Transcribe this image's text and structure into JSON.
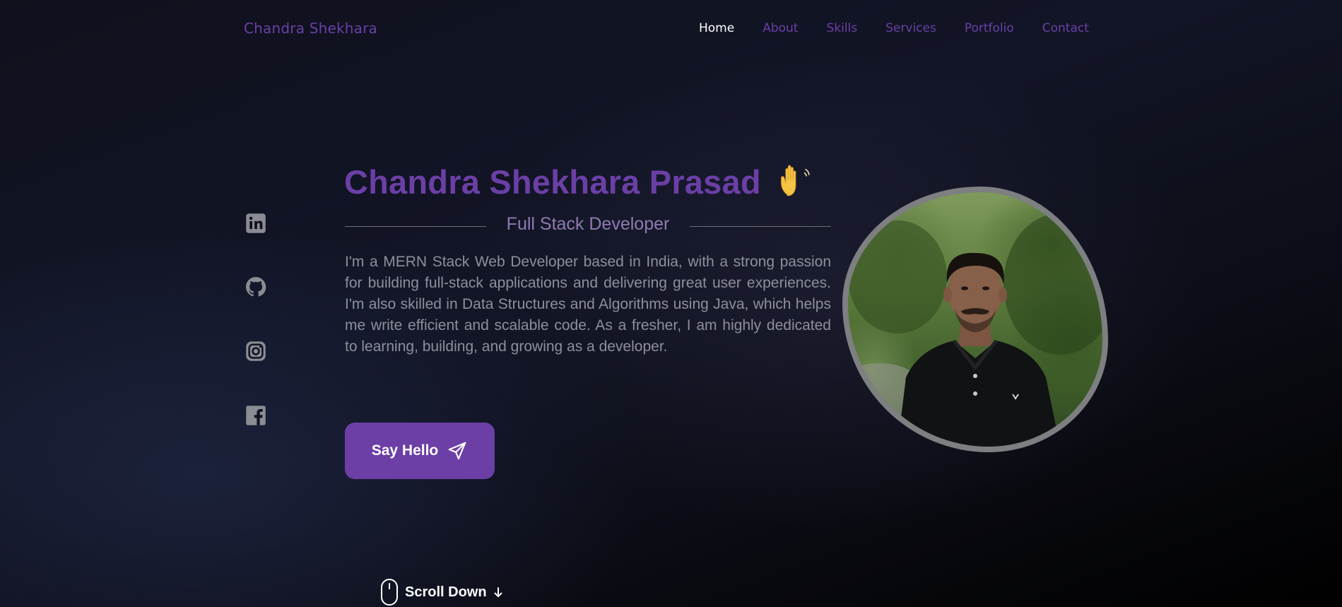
{
  "brand": "Chandra Shekhara",
  "nav": [
    {
      "label": "Home",
      "active": true
    },
    {
      "label": "About",
      "active": false
    },
    {
      "label": "Skills",
      "active": false
    },
    {
      "label": "Services",
      "active": false
    },
    {
      "label": "Portfolio",
      "active": false
    },
    {
      "label": "Contact",
      "active": false
    }
  ],
  "social": [
    "linkedin-icon",
    "github-icon",
    "instagram-icon",
    "facebook-icon"
  ],
  "hero": {
    "name": "Chandra Shekhara Prasad",
    "wave_icon": "waving-hand-icon",
    "subtitle": "Full Stack Developer",
    "bio": "I'm a MERN Stack Web Developer based in India, with a strong passion for building full-stack applications and delivering great user experiences. I'm also skilled in Data Structures and Algorithms using Java, which helps me write efficient and scalable code. As a fresher, I am highly dedicated to learning, building, and growing as a developer.",
    "cta_label": "Say Hello",
    "cta_icon": "send-icon"
  },
  "scroll": {
    "label": "Scroll Down",
    "icon": "mouse-icon",
    "arrow_icon": "arrow-down-icon"
  },
  "colors": {
    "accent": "#6b3fa6",
    "nav_active": "#ffffff",
    "body_text": "#8e8f9c",
    "subtitle": "#8f7bb0",
    "background": "#0f111d"
  }
}
